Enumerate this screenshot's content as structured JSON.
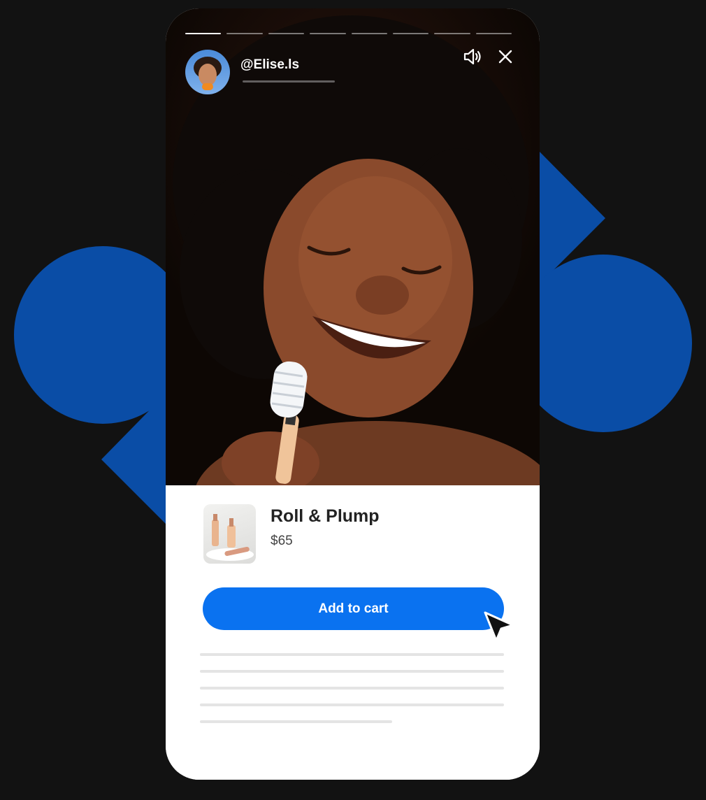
{
  "story": {
    "username": "@Elise.ls",
    "progress_segments": 8,
    "active_segment": 1
  },
  "icons": {
    "volume": "speaker-volume-icon",
    "close": "close-icon",
    "pointer": "mouse-pointer-icon"
  },
  "product": {
    "name": "Roll & Plump",
    "price": "$65",
    "cta_label": "Add to cart"
  },
  "colors": {
    "page_background": "#121212",
    "accent_shapes": "#0a4da6",
    "cta_button": "#0a72f0",
    "card_background": "#ffffff"
  }
}
